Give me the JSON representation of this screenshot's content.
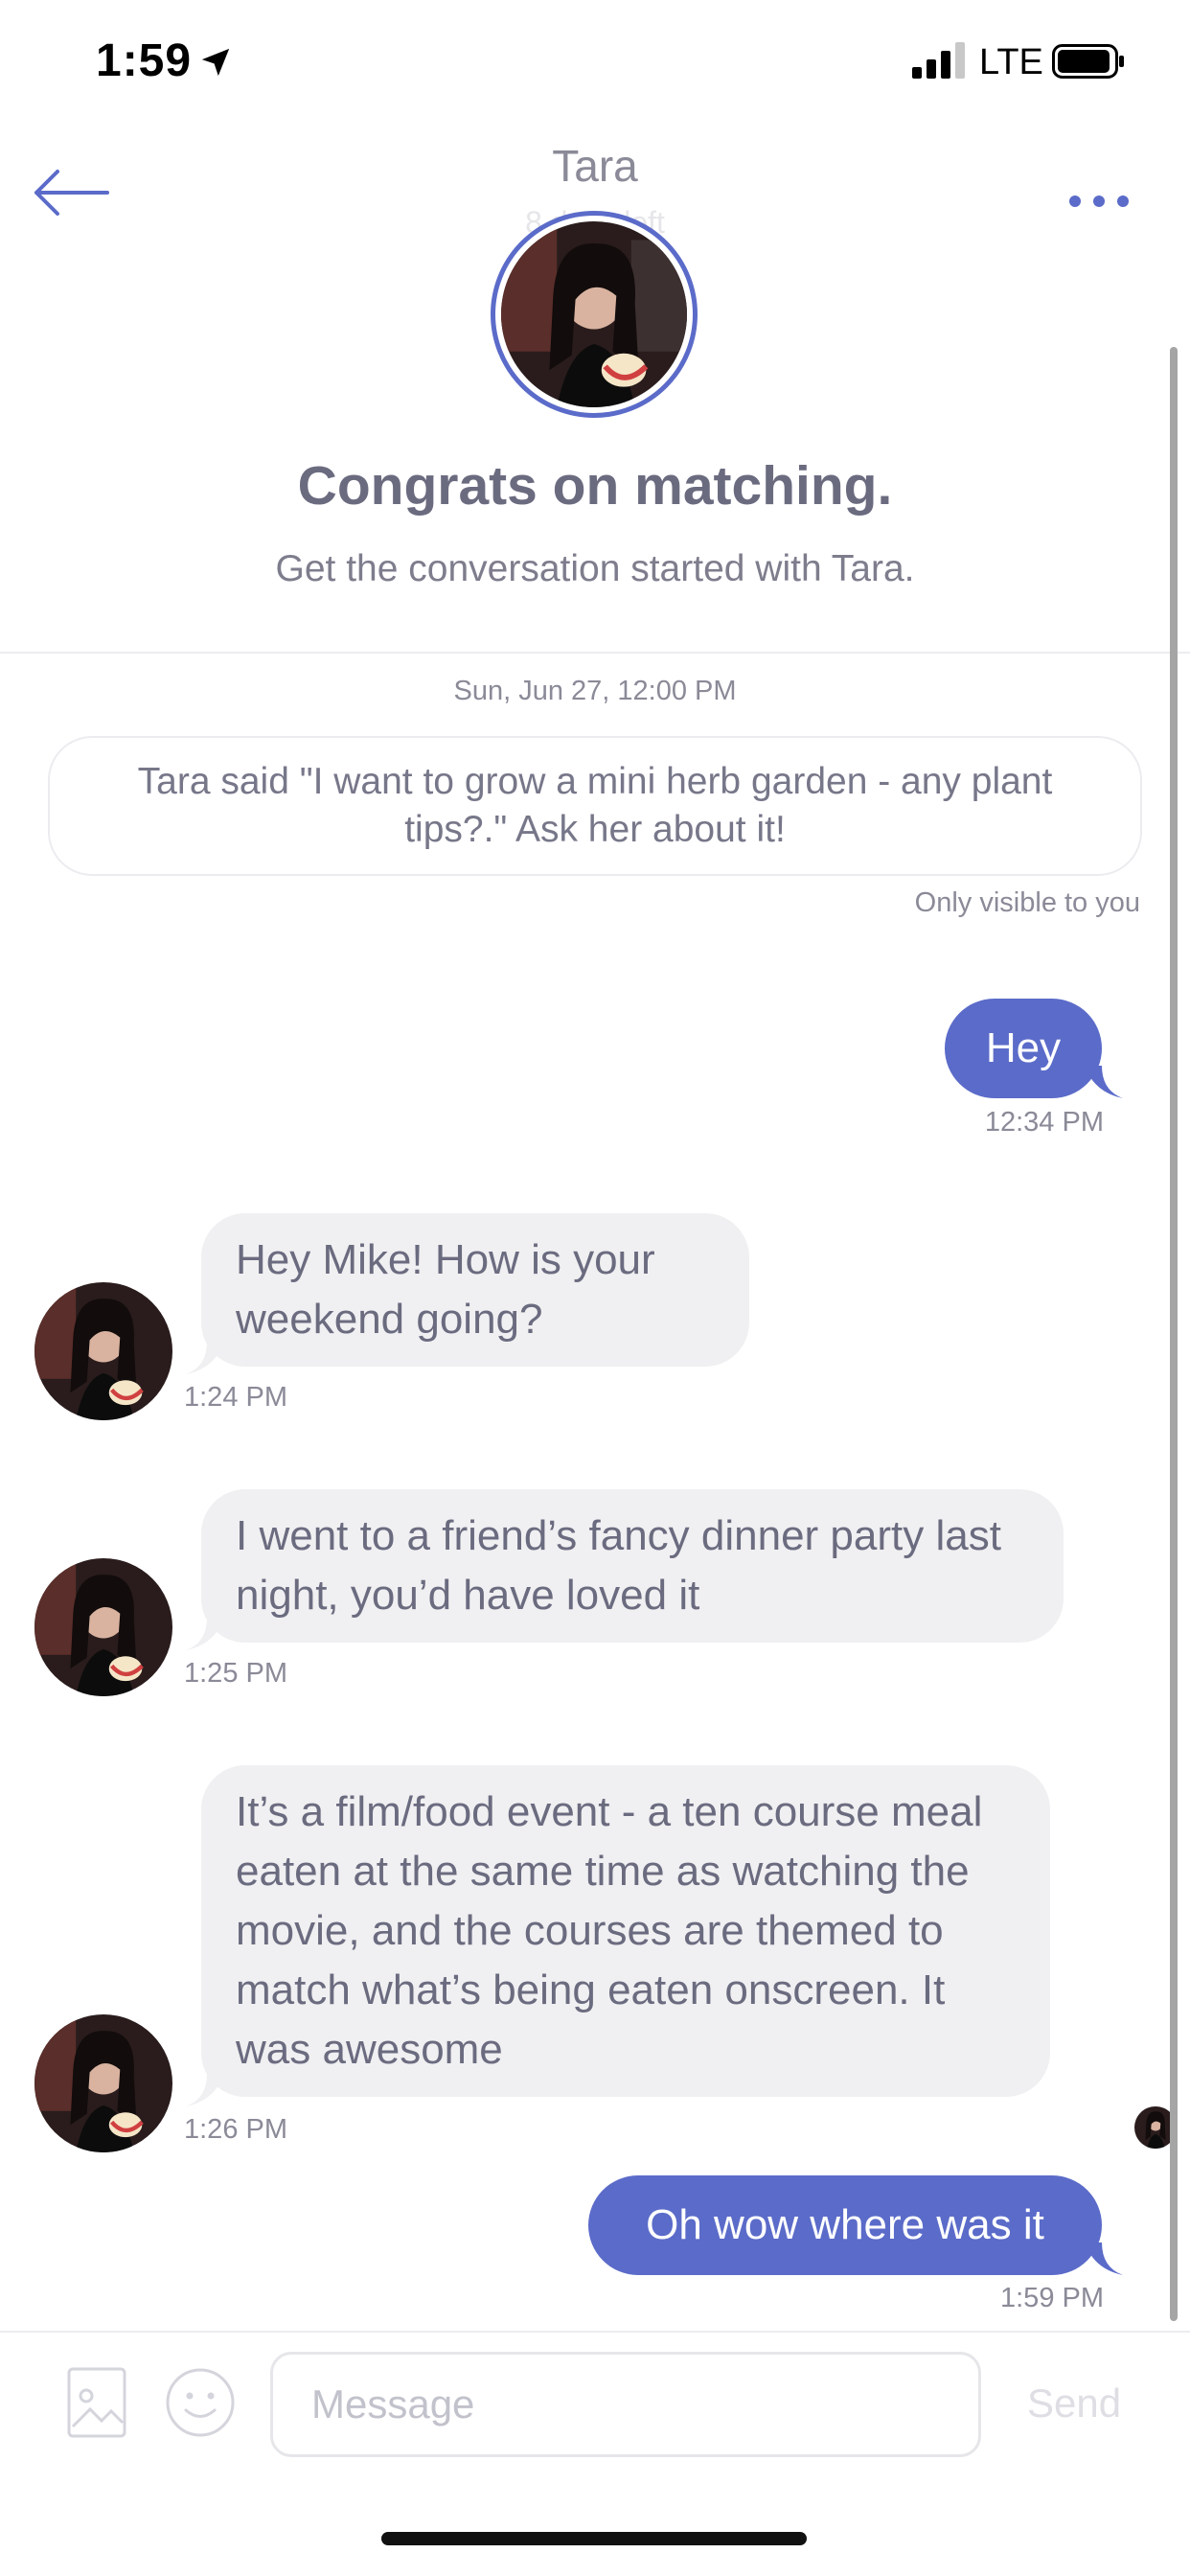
{
  "status_bar": {
    "time": "1:59",
    "network": "LTE"
  },
  "nav": {
    "title": "Tara",
    "subtitle": "8 days left"
  },
  "match": {
    "heading": "Congrats on matching.",
    "subheading": "Get the conversation started with Tara."
  },
  "conversation": {
    "date_stamp": "Sun, Jun 27, 12:00 PM",
    "prompt_card": "Tara said \"I want to grow a mini herb garden - any plant tips?.\" Ask her about it!",
    "prompt_note": "Only visible to you",
    "messages": [
      {
        "from": "me",
        "text": "Hey",
        "time": "12:34 PM"
      },
      {
        "from": "Tara",
        "text": "Hey Mike! How is your weekend going?",
        "time": "1:24 PM"
      },
      {
        "from": "Tara",
        "text": "I went to a friend’s fancy dinner party last night, you’d have loved it",
        "time": "1:25 PM"
      },
      {
        "from": "Tara",
        "text": "It’s a film/food event - a ten course meal eaten at the same time as watching the movie, and the courses are themed to match what’s being eaten onscreen. It was awesome",
        "time": "1:26 PM"
      },
      {
        "from": "me",
        "text": "Oh wow where was it",
        "time": "1:59 PM"
      }
    ]
  },
  "composer": {
    "placeholder": "Message",
    "send_label": "Send"
  },
  "colors": {
    "accent": "#5b6bc9",
    "incoming_bubble": "#f0f0f2",
    "text": "#6b6b80"
  }
}
